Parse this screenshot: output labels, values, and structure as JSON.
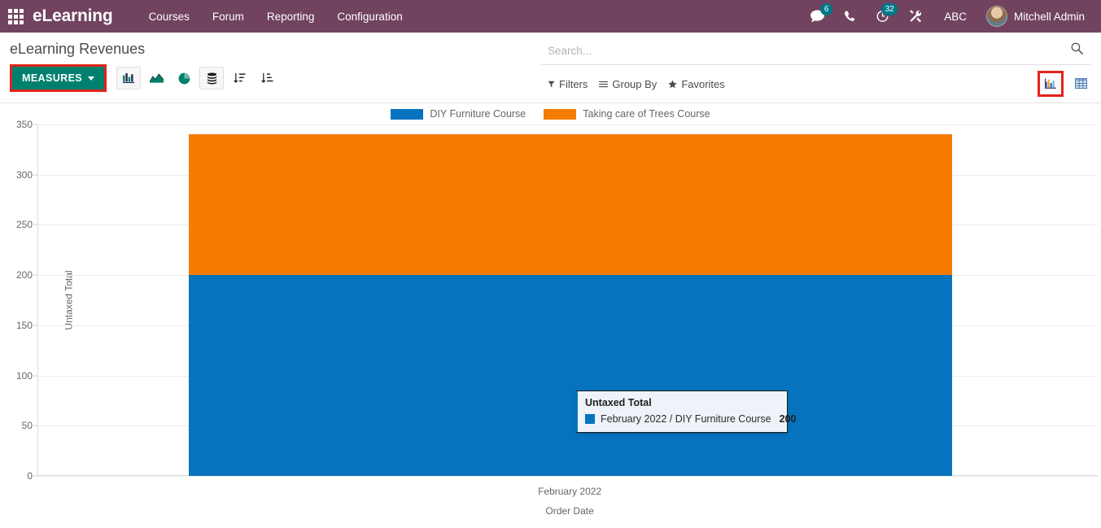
{
  "navbar": {
    "apps_icon": "apps-grid-icon",
    "brand": "eLearning",
    "menu": [
      {
        "label": "Courses"
      },
      {
        "label": "Forum"
      },
      {
        "label": "Reporting"
      },
      {
        "label": "Configuration"
      }
    ],
    "messages_icon": "messages-icon",
    "messages_count": "6",
    "phone_icon": "phone-icon",
    "activities_icon": "activities-clock-icon",
    "activities_count": "32",
    "tools_icon": "tools-icon",
    "debug_label": "ABC",
    "avatar_icon": "user-avatar",
    "user_name": "Mitchell Admin"
  },
  "control_panel": {
    "page_title": "eLearning Revenues",
    "measures_label": "MEASURES",
    "chart_buttons": [
      {
        "name": "bar-chart-icon",
        "active": true
      },
      {
        "name": "line-chart-icon",
        "active": false
      },
      {
        "name": "pie-chart-icon",
        "active": false
      },
      {
        "name": "stacked-database-icon",
        "active": true
      },
      {
        "name": "sort-descending-icon",
        "active": false
      },
      {
        "name": "sort-ascending-icon",
        "active": false
      }
    ],
    "search_placeholder": "Search...",
    "search_value": "",
    "search_icon": "search-icon",
    "filters_label": "Filters",
    "group_by_label": "Group By",
    "favorites_label": "Favorites",
    "view_chart_icon": "graph-view-icon",
    "view_pivot_icon": "pivot-view-icon"
  },
  "colors": {
    "navbar": "#71435f",
    "accent_teal": "#00806e",
    "highlight_red": "#e2231a",
    "series_blue": "#0773be",
    "series_orange": "#f57c00",
    "tooltip_bg": "#edf3f9"
  },
  "chart_data": {
    "type": "bar",
    "subtype": "stacked",
    "title": "",
    "xlabel": "Order Date",
    "ylabel": "Untaxed Total",
    "categories": [
      "February 2022"
    ],
    "series": [
      {
        "name": "DIY Furniture Course",
        "color": "#0773be",
        "values": [
          200
        ]
      },
      {
        "name": "Taking care of Trees Course",
        "color": "#f57c00",
        "values": [
          140
        ]
      }
    ],
    "stack_total": [
      340
    ],
    "ylim": [
      0,
      350
    ],
    "yticks": [
      0,
      50,
      100,
      150,
      200,
      250,
      300,
      350
    ],
    "ytick_labels": [
      "0",
      "50",
      "100",
      "150",
      "200",
      "250",
      "300",
      "350"
    ],
    "grid": true,
    "legend_position": "top"
  },
  "tooltip": {
    "title": "Untaxed Total",
    "swatch_color": "#0773be",
    "entry": "February 2022 / DIY Furniture Course",
    "value": "200"
  }
}
